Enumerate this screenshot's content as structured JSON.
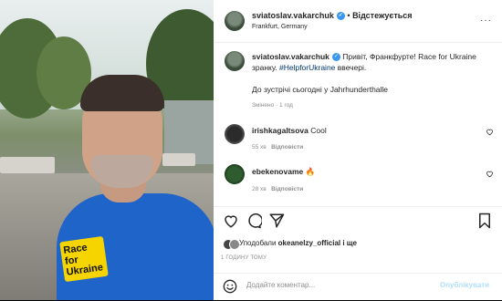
{
  "post": {
    "author": "sviatoslav.vakarchuk",
    "follow_label": "Відстежується",
    "location": "Frankfurt, Germany",
    "caption_line1": "Привіт, Франкфурте! Race for Ukraine",
    "caption_line2a": "зранку. ",
    "caption_hashtag": "#HelpforUkraine",
    "caption_line2b": " ввечері.",
    "caption_line3": "До зустрічі сьогодні у Jahrhunderthalle",
    "caption_meta": "Змінено · 1 год",
    "shirt_text_line1": "Race for",
    "shirt_text_line2": "Ukraine"
  },
  "comments": [
    {
      "user": "irishkagaltsova",
      "text": "Cool",
      "time": "55 хв",
      "reply": "Відповісти"
    },
    {
      "user": "ebekenovame",
      "text": "🔥",
      "time": "28 хв",
      "reply": "Відповісти"
    }
  ],
  "likes": {
    "prefix": "Уподобали ",
    "user": "okeanelzy_official",
    "suffix": " і ще"
  },
  "timestamp": "1 ГОДИНУ ТОМУ",
  "comment_box": {
    "placeholder": "Додайте коментар...",
    "submit_label": "Опублікувати"
  },
  "colors": {
    "verified": "#3897f0",
    "hashtag": "#00376b",
    "muted": "#8e8e8e",
    "submit_disabled": "#b2dffc",
    "shirt": "#1f64c8",
    "badge": "#f5d400"
  },
  "icons": [
    "heart-icon",
    "comment-icon",
    "share-icon",
    "bookmark-icon",
    "emoji-icon",
    "verified-icon",
    "more-options-icon"
  ]
}
